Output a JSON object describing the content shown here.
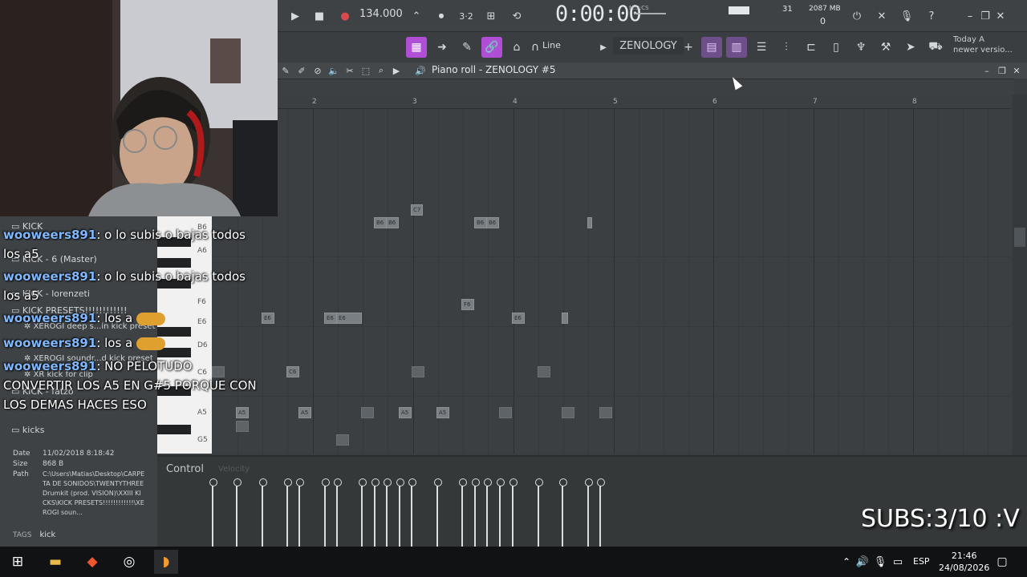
{
  "transport": {
    "tempo": "134.000",
    "time": "0:00:00",
    "time_unit": "M:S:CS",
    "cpu": "31",
    "memory": "2087 MB",
    "memory_sub": "0"
  },
  "toolbar2": {
    "line_mode": "Line",
    "instrument": "ZENOLOGY",
    "news": [
      "Today A",
      "newer versio..."
    ]
  },
  "piano_roll": {
    "title": "Piano roll - ZENOLOGY #5",
    "ruler_numbers": [
      "2",
      "3",
      "4",
      "5",
      "6",
      "7",
      "8"
    ],
    "key_labels": [
      "B6",
      "A6",
      "F6",
      "E6",
      "D6",
      "C6",
      "A5",
      "G5"
    ],
    "note_labels": [
      "C7",
      "B6",
      "B6",
      "B6",
      "B6",
      "F6",
      "E6",
      "E6",
      "E6",
      "E6",
      "C6",
      "A5",
      "A5",
      "A5",
      "A5"
    ]
  },
  "control": {
    "label": "Control",
    "target": "Velocity"
  },
  "browser": {
    "items": [
      "KICK",
      "KICK - 6 (Master)",
      "KICK - lorenzeti",
      "KICK PRESETS!!!!!!!!!!!!",
      "XEROGI deep s...in kick preset",
      "XEROGI soundr...d kick preset",
      "XR kick for clip",
      "KICK - fatzo",
      "kicks"
    ],
    "info_date_label": "Date",
    "info_date": "11/02/2018 8:18:42",
    "info_size_label": "Size",
    "info_size": "868 B",
    "info_path_label": "Path",
    "info_path": "C:\\Users\\Matias\\Desktop\\CARPETA DE SONIDOS\\TWENTYTHREE Drumkit (prod. VISION)\\XXIII KICKS\\KICK PRESETS!!!!!!!!!!!!\\XEROGI soun...",
    "tags_label": "TAGS",
    "tags_value": "kick"
  },
  "chat": [
    {
      "user": "wooweers891",
      "text": ": o lo subis o bajas todos"
    },
    {
      "user": "",
      "text": "los a5"
    },
    {
      "user": "wooweers891",
      "text": ": o lo subis o bajas todos"
    },
    {
      "user": "",
      "text": "los a5"
    },
    {
      "user": "wooweers891",
      "text": ": los a"
    },
    {
      "user": "wooweers891",
      "text": ": los a"
    },
    {
      "user": "wooweers891",
      "text": ": NO PELOTUDO"
    },
    {
      "user": "",
      "text": "CONVERTIR LOS A5 EN G#5 PORQUE CON"
    },
    {
      "user": "",
      "text": "LOS DEMAS HACES ESO"
    }
  ],
  "overlay": {
    "subs": "SUBS:3/10 :V"
  },
  "taskbar": {
    "lang": "ESP",
    "time": "21:46",
    "date": "24/08/2026"
  }
}
